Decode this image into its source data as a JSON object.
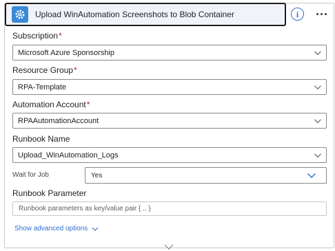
{
  "header": {
    "title": "Upload WinAutomation Screenshots to Blob Container",
    "icon": "automation-gear-icon",
    "accent_color": "#3c8ad6"
  },
  "fields": {
    "subscription": {
      "label": "Subscription",
      "required_mark": "*",
      "value": "Microsoft Azure Sponsorship"
    },
    "resource_group": {
      "label": "Resource Group",
      "required_mark": "*",
      "value": "RPA-Template"
    },
    "automation_account": {
      "label": "Automation Account",
      "required_mark": "*",
      "value": "RPAAutomationAccount"
    },
    "runbook_name": {
      "label": "Runbook Name",
      "value": "Upload_WinAutomation_Logs"
    },
    "wait_for_job": {
      "label": "Wait for Job",
      "value": "Yes"
    },
    "runbook_parameter": {
      "label": "Runbook Parameter",
      "placeholder": "Runbook parameters as key/value pair { .. }"
    }
  },
  "advanced": {
    "label": "Show advanced options"
  },
  "colors": {
    "link": "#2b6ed4",
    "required": "#a4262c"
  }
}
